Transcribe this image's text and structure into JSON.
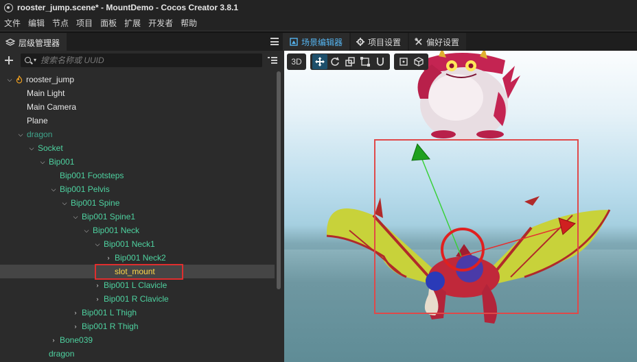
{
  "window": {
    "title": "rooster_jump.scene* - MountDemo - Cocos Creator 3.8.1"
  },
  "menu": [
    "文件",
    "编辑",
    "节点",
    "项目",
    "面板",
    "扩展",
    "开发者",
    "帮助"
  ],
  "hierarchy": {
    "tab_label": "层级管理器",
    "search_placeholder": "搜索名称或 UUID",
    "nodes": [
      {
        "label": "rooster_jump",
        "arrow": "⌵",
        "color": "white"
      },
      {
        "label": "Main Light",
        "arrow": "",
        "color": "white"
      },
      {
        "label": "Main Camera",
        "arrow": "",
        "color": "white"
      },
      {
        "label": "Plane",
        "arrow": "",
        "color": "white"
      },
      {
        "label": "dragon",
        "arrow": "⌵",
        "color": "teal"
      },
      {
        "label": "Socket",
        "arrow": "⌵",
        "color": "green"
      },
      {
        "label": "Bip001",
        "arrow": "⌵",
        "color": "green"
      },
      {
        "label": "Bip001 Footsteps",
        "arrow": "",
        "color": "green"
      },
      {
        "label": "Bip001 Pelvis",
        "arrow": "⌵",
        "color": "green"
      },
      {
        "label": "Bip001 Spine",
        "arrow": "⌵",
        "color": "green"
      },
      {
        "label": "Bip001 Spine1",
        "arrow": "⌵",
        "color": "green"
      },
      {
        "label": "Bip001 Neck",
        "arrow": "⌵",
        "color": "green"
      },
      {
        "label": "Bip001 Neck1",
        "arrow": "⌵",
        "color": "green"
      },
      {
        "label": "Bip001 Neck2",
        "arrow": "›",
        "color": "green"
      },
      {
        "label": "slot_mount",
        "arrow": "",
        "color": "yellow"
      },
      {
        "label": "Bip001 L Clavicle",
        "arrow": "›",
        "color": "green"
      },
      {
        "label": "Bip001 R Clavicle",
        "arrow": "›",
        "color": "green"
      },
      {
        "label": "Bip001 L Thigh",
        "arrow": "›",
        "color": "green"
      },
      {
        "label": "Bip001 R Thigh",
        "arrow": "›",
        "color": "green"
      },
      {
        "label": "Bone039",
        "arrow": "›",
        "color": "green"
      },
      {
        "label": "dragon",
        "arrow": "",
        "color": "green"
      }
    ]
  },
  "scene_tabs": [
    {
      "label": "场景编辑器",
      "icon": "scene-icon"
    },
    {
      "label": "项目设置",
      "icon": "gear-icon"
    },
    {
      "label": "偏好设置",
      "icon": "tools-icon"
    }
  ],
  "scene_toolbar": {
    "mode_3d": "3D"
  }
}
